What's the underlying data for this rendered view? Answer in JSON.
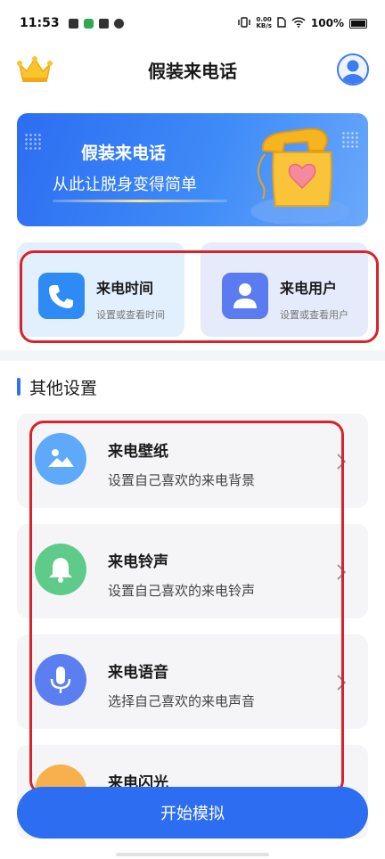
{
  "status_bar": {
    "time": "11:53",
    "net_speed_value": "0.00",
    "net_speed_unit": "KB/s",
    "battery": "100%"
  },
  "header": {
    "title": "假装来电话",
    "crown_icon": "crown-icon",
    "avatar_icon": "user-avatar-icon"
  },
  "banner": {
    "title": "假装来电话",
    "subtitle": "从此让脱身变得简单"
  },
  "features": [
    {
      "title": "来电时间",
      "desc": "设置或查看时间",
      "icon": "phone-icon"
    },
    {
      "title": "来电用户",
      "desc": "设置或查看用户",
      "icon": "user-icon"
    }
  ],
  "other_settings": {
    "title": "其他设置",
    "items": [
      {
        "title": "来电壁纸",
        "desc": "设置自己喜欢的来电背景",
        "icon": "image-icon",
        "color": "#5fa9fa"
      },
      {
        "title": "来电铃声",
        "desc": "设置自己喜欢的来电铃声",
        "icon": "bell-icon",
        "color": "#5ecb8a"
      },
      {
        "title": "来电语音",
        "desc": "选择自己喜欢的来电声音",
        "icon": "microphone-icon",
        "color": "#5b7ff0"
      },
      {
        "title": "来电闪光",
        "desc": "",
        "icon": "flash-icon",
        "color": "#f7b04d"
      }
    ]
  },
  "start_button": {
    "label": "开始模拟"
  },
  "colors": {
    "accent": "#2c6df2",
    "highlight_border": "#d8232a"
  }
}
